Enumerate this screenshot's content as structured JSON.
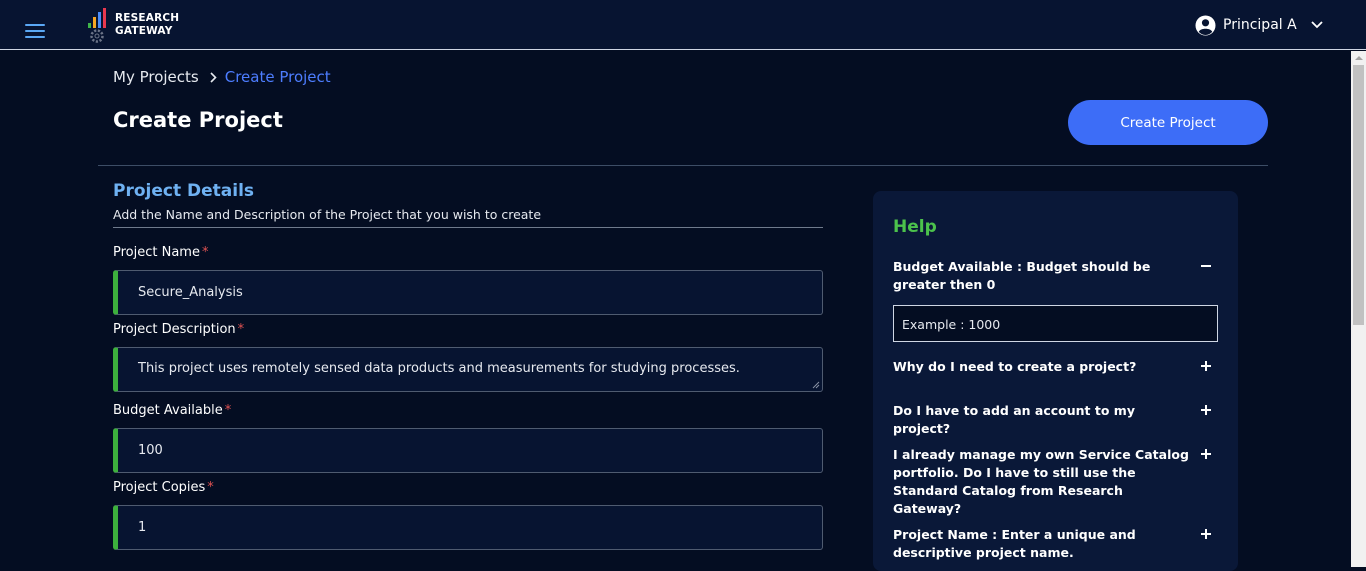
{
  "app": {
    "logo_line1": "RESEARCH",
    "logo_line2": "GATEWAY",
    "user_name": "Principal A"
  },
  "icons": {
    "menu": "hamburger-menu-icon",
    "user": "account-circle-icon",
    "dropdown": "chevron-down-icon",
    "breadcrumb_separator": "chevron-right-icon"
  },
  "breadcrumb": [
    "My Projects",
    "Create Project"
  ],
  "page": {
    "title": "Create Project",
    "create_button": "Create Project"
  },
  "form": {
    "section_title": "Project Details",
    "section_subtitle": "Add the Name and Description of the Project that you wish to create",
    "required_marker": "*",
    "fields": [
      {
        "label": "Project Name",
        "value": "Secure_Analysis"
      },
      {
        "label": "Project Description",
        "value": "This project uses remotely sensed data products and measurements for studying processes."
      },
      {
        "label": "Budget Available",
        "value": "100"
      },
      {
        "label": "Project Copies",
        "value": "1"
      }
    ]
  },
  "help": {
    "title": "Help",
    "items": [
      {
        "question": "Budget Available : Budget should be greater then 0",
        "expanded": true,
        "answer": "Example : 1000"
      },
      {
        "question": "Why do I need to create a project?",
        "expanded": false
      },
      {
        "question": "Do I have to add an account to my project?",
        "expanded": false
      },
      {
        "question": "I already manage my own Service Catalog portfolio. Do I have to still use the Standard Catalog from Research Gateway?",
        "expanded": false
      },
      {
        "question": "Project Name : Enter a unique and descriptive project name.",
        "expanded": false
      }
    ]
  },
  "colors": {
    "page_background": "#040d22",
    "topbar": "#071431",
    "accent_button": "#3d6df7",
    "link": "#4d7dff",
    "section_title": "#6fb1f2",
    "help_title": "#4cc24c",
    "valid_field_border": "#3db03d",
    "required": "#e05252"
  }
}
